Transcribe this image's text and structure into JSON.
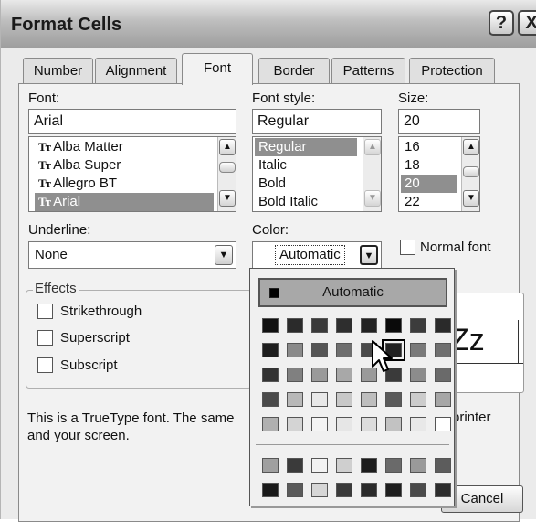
{
  "window": {
    "title": "Format Cells",
    "help_label": "?",
    "close_label": "X"
  },
  "tabs": [
    {
      "label": "Number",
      "u": ""
    },
    {
      "label": "Alignment",
      "u": ""
    },
    {
      "label": "Font",
      "u": ""
    },
    {
      "label": "Border",
      "u": ""
    },
    {
      "label": "Patterns",
      "u": ""
    },
    {
      "label": "Protection",
      "u": ""
    }
  ],
  "font": {
    "label": "Font:",
    "value": "Arial",
    "items": [
      {
        "label": "Alba Matter",
        "icon": "Tт"
      },
      {
        "label": "Alba Super",
        "icon": "Tт"
      },
      {
        "label": "Allegro BT",
        "icon": "Tт"
      },
      {
        "label": "Arial",
        "icon": "Tт"
      }
    ]
  },
  "style": {
    "label": "Font style:",
    "value": "Regular",
    "items": [
      "Regular",
      "Italic",
      "Bold",
      "Bold Italic"
    ]
  },
  "size": {
    "label": "Size:",
    "value": "20",
    "items": [
      "16",
      "18",
      "20",
      "22"
    ]
  },
  "underline": {
    "label": "Underline:",
    "value": "None"
  },
  "color": {
    "label": "Color:",
    "value": "Automatic"
  },
  "normal_font": {
    "label": "Normal font"
  },
  "effects": {
    "label": "Effects",
    "items": [
      "Strikethrough",
      "Superscript",
      "Subscript"
    ]
  },
  "preview": {
    "text": "Zz"
  },
  "info": {
    "line1_left": "This is a TrueType font.  The same",
    "line1_right": "printer",
    "line2": "and your screen."
  },
  "buttons": {
    "cancel": "Cancel"
  },
  "palette": {
    "automatic_label": "Automatic",
    "rows": [
      [
        "#111111",
        "#2b2b2b",
        "#3a3a3a",
        "#2e2e2e",
        "#222222",
        "#0a0a0a",
        "#3c3c3c",
        "#2a2a2a"
      ],
      [
        "#1e1e1e",
        "#8a8a8a",
        "#555555",
        "#6e6e6e",
        "#4a4a4a",
        "#222222",
        "#7a7a7a",
        "#707070"
      ],
      [
        "#333333",
        "#808080",
        "#9a9a9a",
        "#a8a8a8",
        "#9a9a9a",
        "#3a3a3a",
        "#8c8c8c",
        "#6a6a6a"
      ],
      [
        "#4a4a4a",
        "#b8b8b8",
        "#e8e8e8",
        "#c8c8c8",
        "#bebebe",
        "#5a5a5a",
        "#cccccc",
        "#a6a6a6"
      ],
      [
        "#b0b0b0",
        "#d4d4d4",
        "#f4f4f4",
        "#e6e6e6",
        "#dcdcdc",
        "#c2c2c2",
        "#e8e8e8",
        "#ffffff"
      ],
      [
        "#a0a0a0",
        "#3a3a3a",
        "#f2f2f2",
        "#cfcfcf",
        "#1c1c1c",
        "#6a6a6a",
        "#9a9a9a",
        "#5c5c5c"
      ],
      [
        "#1a1a1a",
        "#5a5a5a",
        "#d6d6d6",
        "#3a3a3a",
        "#2a2a2a",
        "#1e1e1e",
        "#4a4a4a",
        "#2c2c2c"
      ]
    ],
    "selected": [
      1,
      5
    ]
  }
}
